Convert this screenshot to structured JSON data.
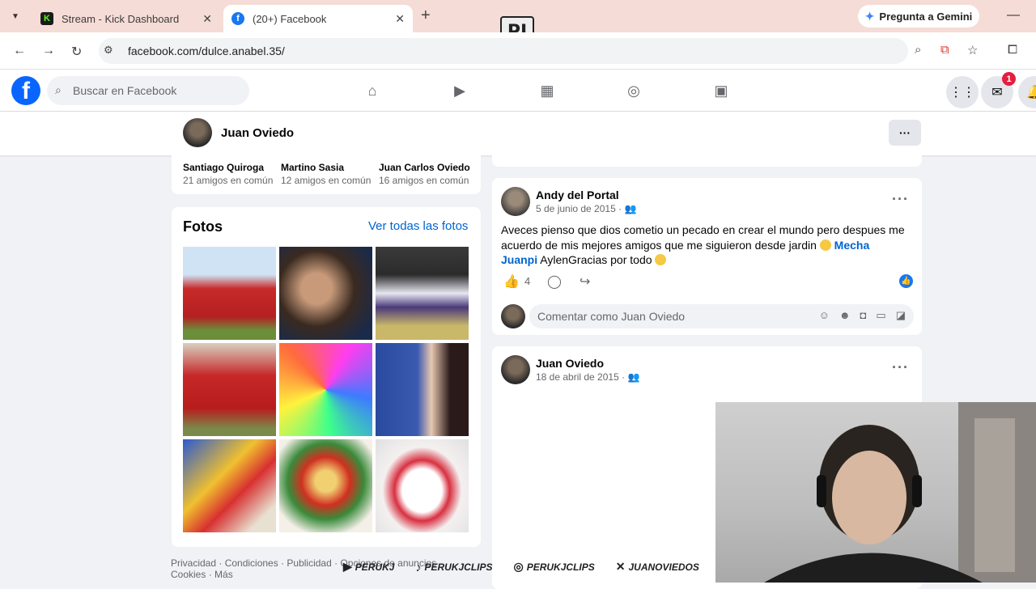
{
  "browser": {
    "tabs": [
      {
        "title": "Stream - Kick Dashboard",
        "favicon": "K"
      },
      {
        "title": "(20+) Facebook",
        "favicon": "f"
      }
    ],
    "gemini_label": "Pregunta a Gemini",
    "url": "facebook.com/dulce.anabel.35/",
    "overlay_logo": "PJ"
  },
  "fb": {
    "logo": "f",
    "search_placeholder": "Buscar en Facebook",
    "notification_count": "1"
  },
  "profile": {
    "name": "Juan Oviedo",
    "more": "···"
  },
  "friends": [
    {
      "name": "Santiago Quiroga",
      "mutual": "21 amigos en común"
    },
    {
      "name": "Martino Sasia",
      "mutual": "12 amigos en común"
    },
    {
      "name": "Juan Carlos Oviedo",
      "mutual": "16 amigos en común"
    }
  ],
  "photos": {
    "title": "Fotos",
    "see_all": "Ver todas las fotos"
  },
  "footer": {
    "line1": "Privacidad · Condiciones · Publicidad · Opciones de anuncios",
    "line2": "Cookies · Más"
  },
  "posts": [
    {
      "author": "Andy del Portal",
      "date": "5 de junio de 2015 ·",
      "text_before": "Aveces pienso que dios cometio un pecado en crear el mundo pero despues me acuerdo de mis mejores amigos que me siguieron desde jardin ",
      "tag": "Mecha Juanpi",
      "text_after": " AylenGracias por todo ",
      "likes": "4",
      "comment_placeholder": "Comentar como Juan Oviedo"
    },
    {
      "author": "Juan Oviedo",
      "date": "18 de abril de 2015 ·"
    }
  ],
  "socials": [
    {
      "icon": "youtube-icon",
      "handle": "PERUKJ"
    },
    {
      "icon": "tiktok-icon",
      "handle": "PERUKJCLIPS"
    },
    {
      "icon": "instagram-icon",
      "handle": "PERUKJCLIPS"
    },
    {
      "icon": "x-icon",
      "handle": "JUANOVIEDOS"
    }
  ]
}
